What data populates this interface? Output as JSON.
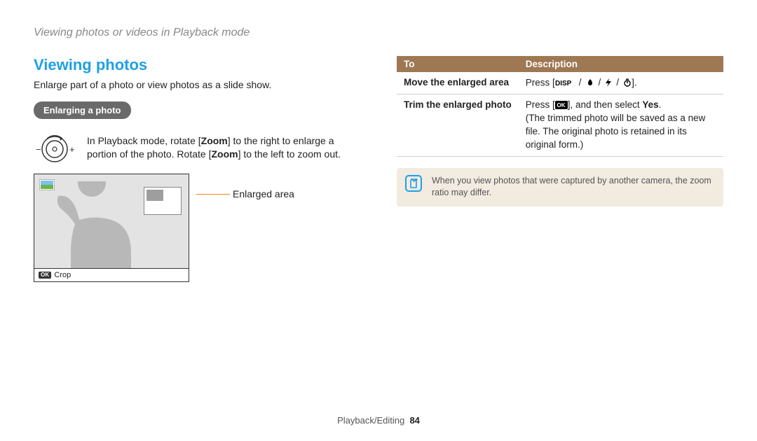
{
  "breadcrumb": "Viewing photos or videos in Playback mode",
  "left": {
    "title": "Viewing photos",
    "intro": "Enlarge part of a photo or view photos as a slide show.",
    "pill": "Enlarging a photo",
    "zoom_prefix": "In Playback mode, rotate [",
    "zoom_bold1": "Zoom",
    "zoom_mid": "] to the right to enlarge a portion of the photo. Rotate [",
    "zoom_bold2": "Zoom",
    "zoom_suffix": "] to the left to zoom out.",
    "crop_label": "Crop",
    "callout": "Enlarged area"
  },
  "table": {
    "head_to": "To",
    "head_desc": "Description",
    "row1_to": "Move the enlarged area",
    "row1_desc_prefix": "Press [",
    "row1_desc_suffix": "].",
    "row2_to": "Trim the enlarged photo",
    "row2_desc_l1_prefix": "Press [",
    "row2_desc_l1_mid": "], and then select ",
    "row2_desc_l1_bold": "Yes",
    "row2_desc_l1_suffix": ".",
    "row2_desc_l2": "(The trimmed photo will be saved as a new file. The original photo is retained in its original form.)"
  },
  "note": "When you view photos that were captured by another camera, the zoom ratio may differ.",
  "footer": {
    "section": "Playback/Editing",
    "page": "84"
  }
}
